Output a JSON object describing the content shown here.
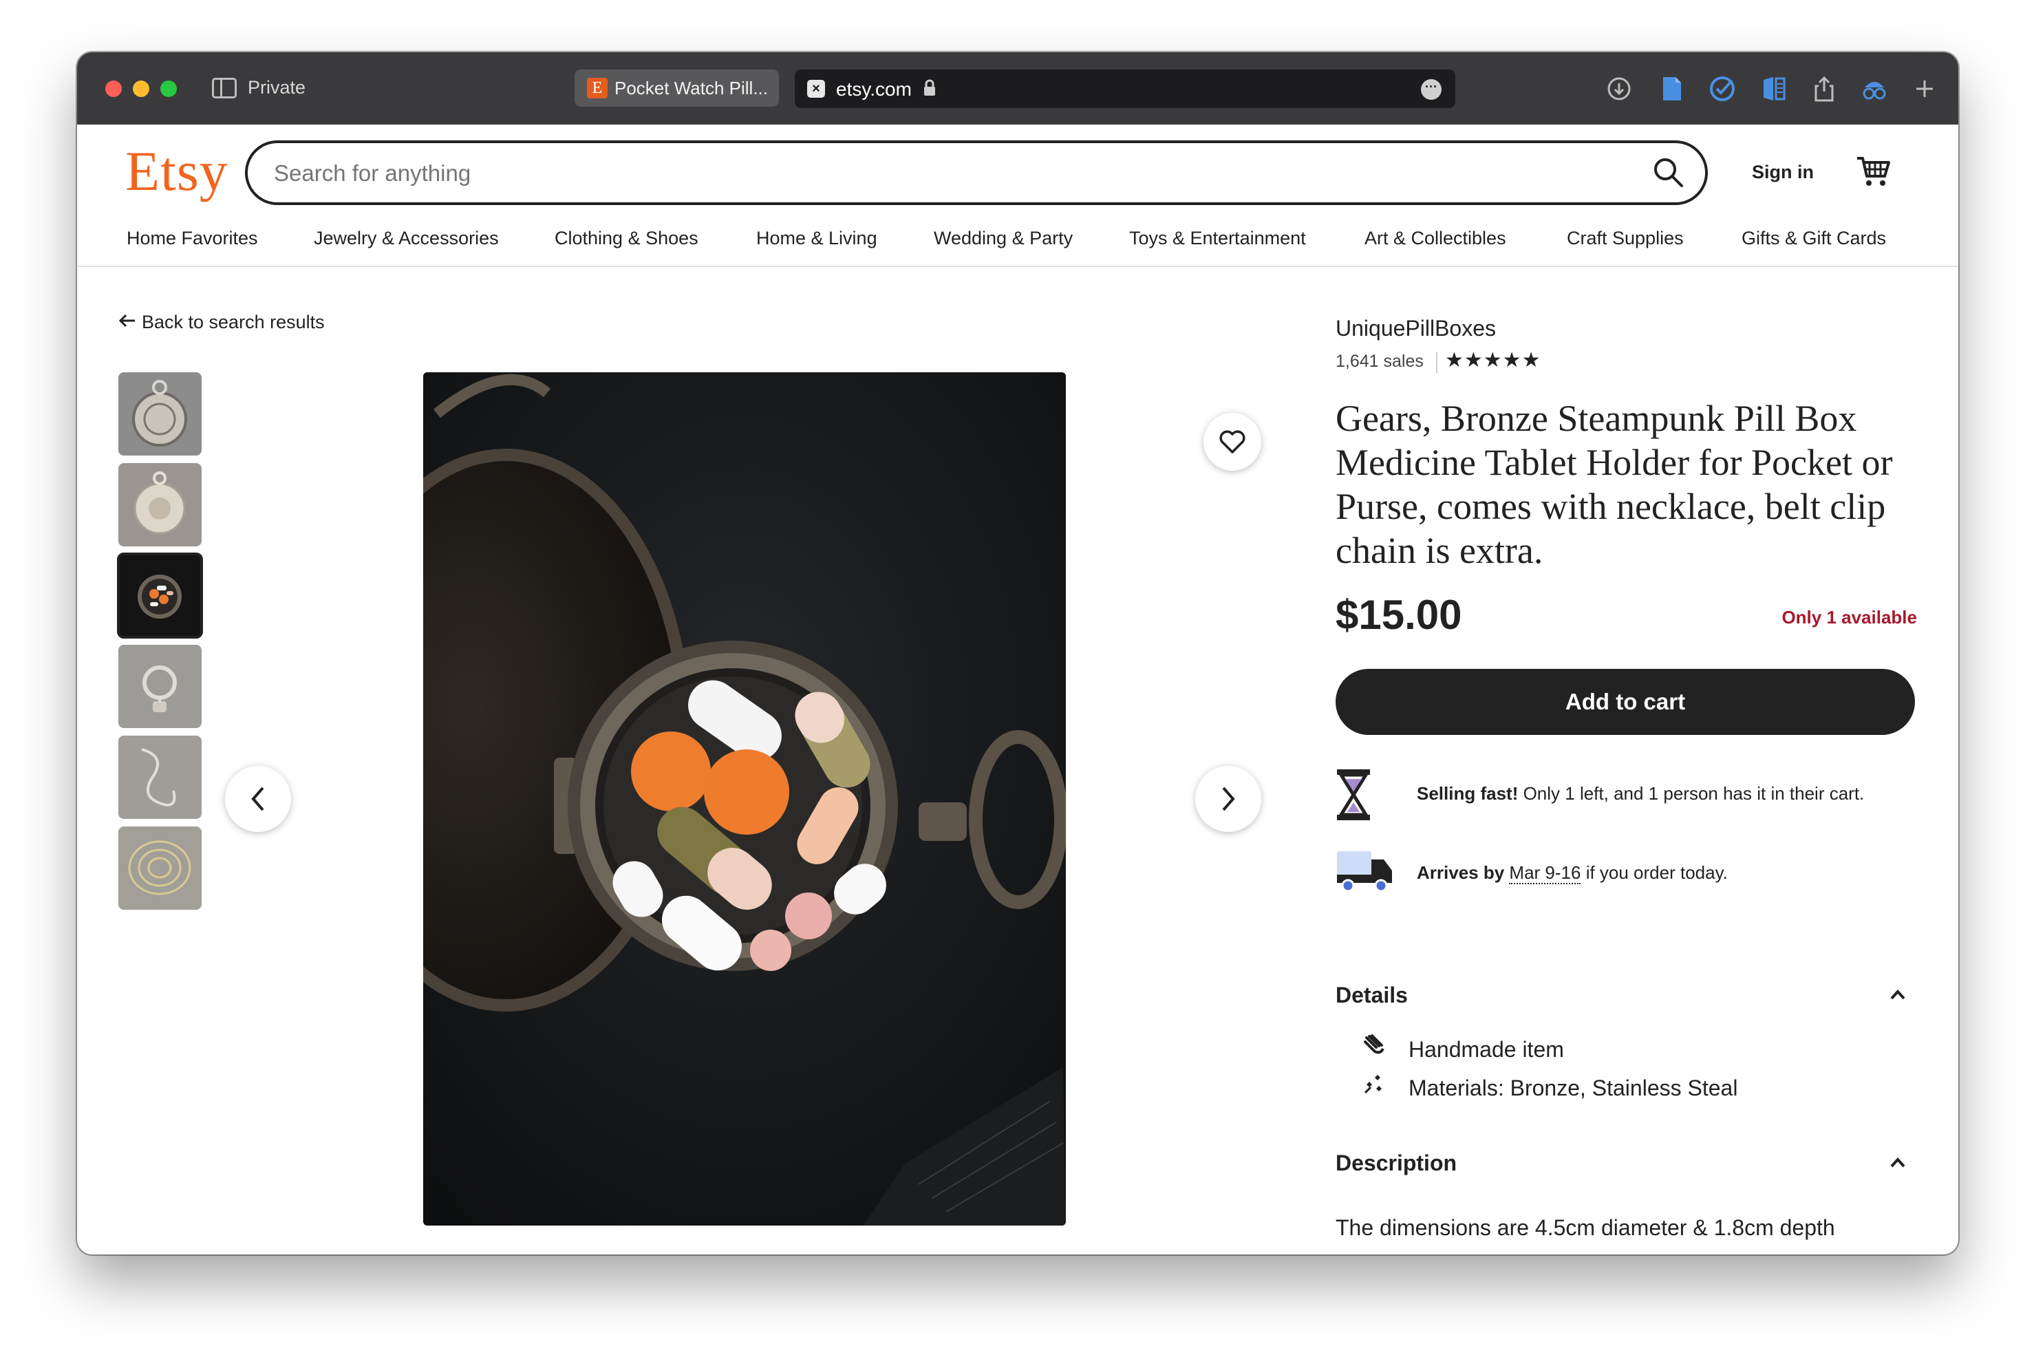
{
  "browser": {
    "private_label": "Private",
    "tab_title": "Pocket Watch Pill...",
    "tab_favicon": "E",
    "address": "etsy.com"
  },
  "header": {
    "logo": "Etsy",
    "search_placeholder": "Search for anything",
    "sign_in": "Sign in"
  },
  "nav": {
    "items": [
      "Home Favorites",
      "Jewelry & Accessories",
      "Clothing & Shoes",
      "Home & Living",
      "Wedding & Party",
      "Toys & Entertainment",
      "Art & Collectibles",
      "Craft Supplies",
      "Gifts & Gift Cards"
    ]
  },
  "gallery": {
    "back_label": "Back to search results",
    "thumbnail_count": 6,
    "selected_index": 2
  },
  "listing": {
    "shop_name": "UniquePillBoxes",
    "sales": "1,641 sales",
    "rating_stars": "★★★★★",
    "title": "Gears, Bronze Steampunk Pill Box Medicine Tablet Holder for Pocket or Purse, comes with necklace, belt clip chain is extra.",
    "price": "$15.00",
    "availability": "Only 1 available",
    "add_to_cart": "Add to cart",
    "selling_fast_bold": "Selling fast!",
    "selling_fast_rest": " Only 1 left, and 1 person has it in their cart.",
    "arrives_bold": "Arrives by",
    "arrives_date": "Mar 9-16",
    "arrives_rest": " if you order today."
  },
  "details": {
    "heading": "Details",
    "items": [
      "Handmade item",
      "Materials: Bronze, Stainless Steal"
    ]
  },
  "description": {
    "heading": "Description",
    "text": "The dimensions are 4.5cm diameter & 1.8cm depth"
  },
  "colors": {
    "brand": "#f1641e",
    "availability": "#a61a2e",
    "cart_button": "#222222"
  }
}
